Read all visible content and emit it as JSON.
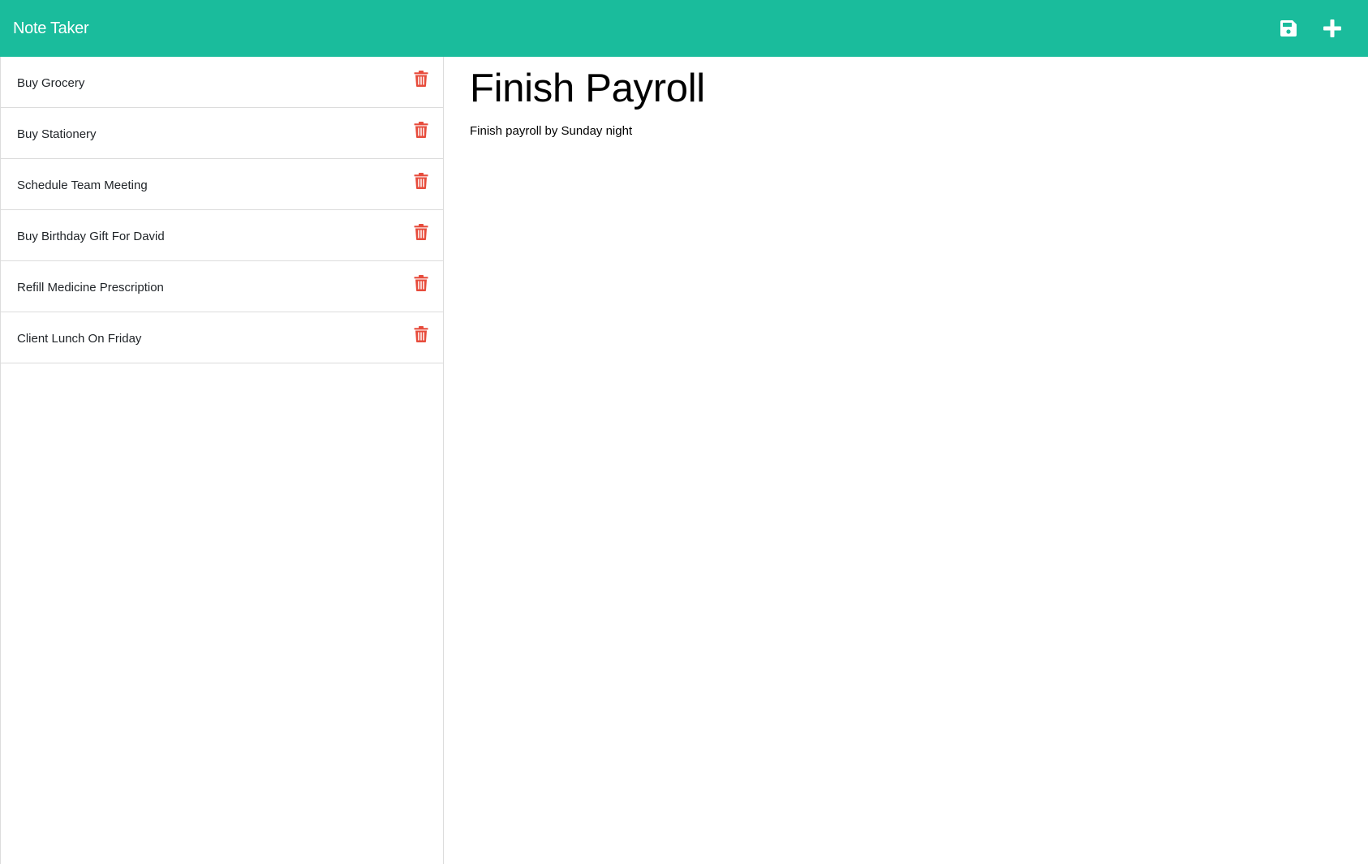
{
  "app": {
    "brand": "Note Taker"
  },
  "header": {
    "actions": [
      {
        "icon": "save-icon"
      },
      {
        "icon": "plus-icon"
      }
    ]
  },
  "sidebar": {
    "notes": [
      {
        "title": "Buy Grocery",
        "icon": "trash-icon"
      },
      {
        "title": "Buy Stationery",
        "icon": "trash-icon"
      },
      {
        "title": "Schedule Team Meeting",
        "icon": "trash-icon"
      },
      {
        "title": "Buy Birthday Gift For David",
        "icon": "trash-icon"
      },
      {
        "title": "Refill Medicine Prescription",
        "icon": "trash-icon"
      },
      {
        "title": "Client Lunch On Friday",
        "icon": "trash-icon"
      }
    ]
  },
  "editor": {
    "title": "Finish Payroll",
    "text": "Finish payroll by Sunday night"
  },
  "colors": {
    "navbar": "#1abc9c",
    "delete": "#e74c3c",
    "nav_icon": "#ffffff"
  }
}
